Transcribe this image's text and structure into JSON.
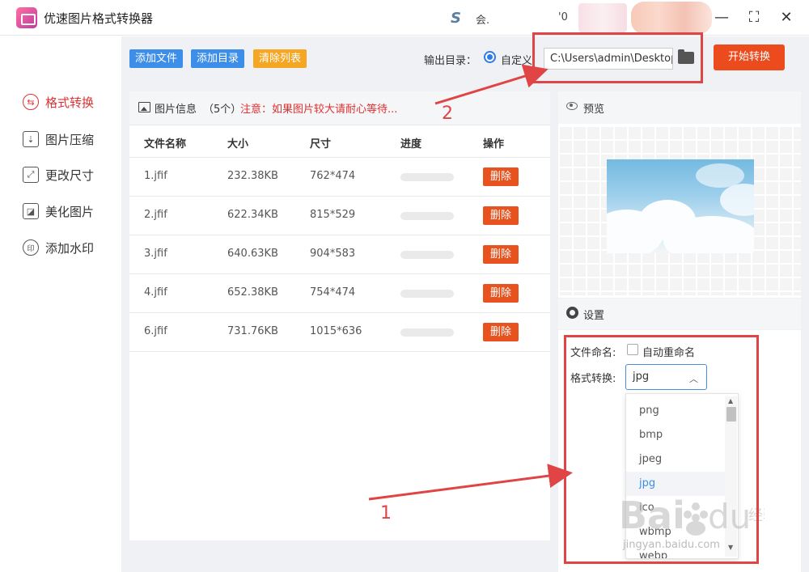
{
  "titlebar": {
    "app_title": "优速图片格式转换器",
    "user_icon": "S",
    "user_name": "会.",
    "user_extra": "'0",
    "minimize": "—",
    "maximize": "⛶",
    "close": "✕"
  },
  "sidebar": {
    "items": [
      {
        "label": "格式转换",
        "icon": "swap-icon",
        "glyph": "⇆",
        "active": true
      },
      {
        "label": "图片压缩",
        "icon": "compress-icon",
        "glyph": "⇣",
        "active": false
      },
      {
        "label": "更改尺寸",
        "icon": "resize-icon",
        "glyph": "⤢",
        "active": false
      },
      {
        "label": "美化图片",
        "icon": "beautify-icon",
        "glyph": "◪",
        "active": false
      },
      {
        "label": "添加水印",
        "icon": "watermark-icon",
        "glyph": "印",
        "active": false
      }
    ]
  },
  "toolbar": {
    "add_file": "添加文件",
    "add_dir": "添加目录",
    "clear_list": "清除列表",
    "output_label": "输出目录：",
    "custom_option": "自定义",
    "output_path": "C:\\Users\\admin\\Desktop",
    "start": "开始转换"
  },
  "file_panel": {
    "title": "图片信息",
    "count": "（5个）",
    "note": "注意：如果图片较大请耐心等待...",
    "columns": [
      "文件名称",
      "大小",
      "尺寸",
      "进度",
      "操作"
    ],
    "rows": [
      {
        "name": "1.jfif",
        "size": "232.38KB",
        "dims": "762*474",
        "progress": 0,
        "action": "删除"
      },
      {
        "name": "2.jfif",
        "size": "622.34KB",
        "dims": "815*529",
        "progress": 0,
        "action": "删除"
      },
      {
        "name": "3.jfif",
        "size": "640.63KB",
        "dims": "904*583",
        "progress": 0,
        "action": "删除"
      },
      {
        "name": "4.jfif",
        "size": "652.38KB",
        "dims": "754*474",
        "progress": 0,
        "action": "删除"
      },
      {
        "name": "6.jfif",
        "size": "731.76KB",
        "dims": "1015*636",
        "progress": 0,
        "action": "删除"
      }
    ]
  },
  "preview": {
    "title": "预览"
  },
  "settings": {
    "title": "设置",
    "naming_label": "文件命名:",
    "auto_rename": "自动重命名",
    "format_label": "格式转换:",
    "format_value": "jpg",
    "options": [
      "png",
      "bmp",
      "jpeg",
      "jpg",
      "ico",
      "wbmp",
      "webp"
    ],
    "selected": "jpg"
  },
  "annotations": {
    "num1": "1",
    "num2": "2"
  },
  "watermark": {
    "text": "jingyan.baidu.com"
  },
  "colors": {
    "accent_blue": "#3c8ee8",
    "clear_orange": "#f5a623",
    "start_red": "#ec4b1e",
    "delete_red": "#e8521f",
    "annotation_red": "#e04444",
    "active_nav": "#d33"
  }
}
